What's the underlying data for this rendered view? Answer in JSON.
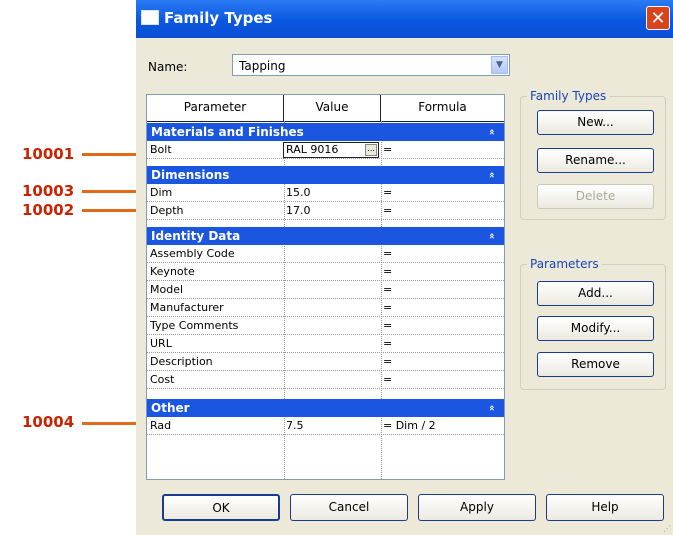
{
  "callouts": [
    {
      "label": "10001"
    },
    {
      "label": "10003"
    },
    {
      "label": "10002"
    },
    {
      "label": "10004"
    }
  ],
  "window": {
    "title": "Family Types",
    "close_glyph": "✕"
  },
  "name_field": {
    "label": "Name:",
    "value": "Tapping"
  },
  "grid": {
    "columns": [
      "Parameter",
      "Value",
      "Formula"
    ],
    "groups": {
      "materials": "Materials and Finishes",
      "dimensions": "Dimensions",
      "identity": "Identity Data",
      "other": "Other"
    },
    "bolt": {
      "param": "Bolt",
      "value": "RAL 9016",
      "formula": "="
    },
    "dim": {
      "param": "Dim",
      "value": "15.0",
      "formula": "="
    },
    "depth": {
      "param": "Depth",
      "value": "17.0",
      "formula": "="
    },
    "identity_rows": [
      {
        "param": "Assembly Code",
        "formula": "="
      },
      {
        "param": "Keynote",
        "formula": "="
      },
      {
        "param": "Model",
        "formula": "="
      },
      {
        "param": "Manufacturer",
        "formula": "="
      },
      {
        "param": "Type Comments",
        "formula": "="
      },
      {
        "param": "URL",
        "formula": "="
      },
      {
        "param": "Description",
        "formula": "="
      },
      {
        "param": "Cost",
        "formula": "="
      }
    ],
    "rad": {
      "param": "Rad",
      "value": "7.5",
      "formula": "= Dim / 2"
    },
    "chevron": "«",
    "browse": "..."
  },
  "family_types_group": {
    "legend": "Family Types",
    "new": "New...",
    "rename": "Rename...",
    "delete": "Delete"
  },
  "parameters_group": {
    "legend": "Parameters",
    "add": "Add...",
    "modify": "Modify...",
    "remove": "Remove"
  },
  "footer": {
    "ok": "OK",
    "cancel": "Cancel",
    "apply": "Apply",
    "help": "Help"
  },
  "colors": {
    "title_bar": "#0a57e0",
    "group_header": "#1a56e0",
    "callout_text": "#cc2200",
    "callout_line": "#e06a1a"
  }
}
